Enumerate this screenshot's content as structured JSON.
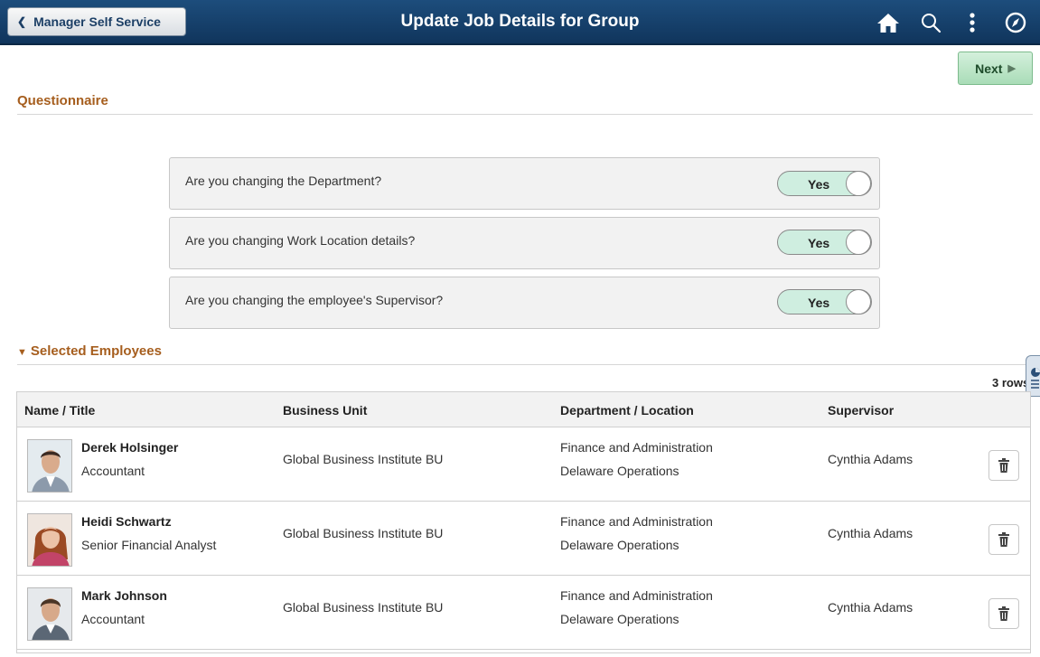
{
  "header": {
    "back_label": "Manager Self Service",
    "title": "Update Job Details for Group",
    "icons": [
      "home-icon",
      "search-icon",
      "actions-icon",
      "navbar-icon"
    ]
  },
  "toolbar": {
    "next_label": "Next"
  },
  "questionnaire": {
    "heading": "Questionnaire",
    "questions": [
      {
        "text": "Are you changing the Department?",
        "value": "Yes"
      },
      {
        "text": "Are you changing Work Location details?",
        "value": "Yes"
      },
      {
        "text": "Are you changing the employee's Supervisor?",
        "value": "Yes"
      }
    ]
  },
  "employees": {
    "heading": "Selected Employees",
    "row_count": "3 rows",
    "columns": [
      "Name / Title",
      "Business Unit",
      "Department / Location",
      "Supervisor"
    ],
    "rows": [
      {
        "name": "Derek Holsinger",
        "title": "Accountant",
        "business_unit": "Global Business Institute BU",
        "department": "Finance and Administration",
        "location": "Delaware Operations",
        "supervisor": "Cynthia Adams"
      },
      {
        "name": "Heidi Schwartz",
        "title": "Senior Financial Analyst",
        "business_unit": "Global Business Institute BU",
        "department": "Finance and Administration",
        "location": "Delaware Operations",
        "supervisor": "Cynthia Adams"
      },
      {
        "name": "Mark Johnson",
        "title": "Accountant",
        "business_unit": "Global Business Institute BU",
        "department": "Finance and Administration",
        "location": "Delaware Operations",
        "supervisor": "Cynthia Adams"
      }
    ]
  },
  "colors": {
    "banner": "#1d4d7c",
    "section_heading": "#a65e1e",
    "toggle_on": "#cfeee0",
    "next_button": "#a9dcb7"
  }
}
